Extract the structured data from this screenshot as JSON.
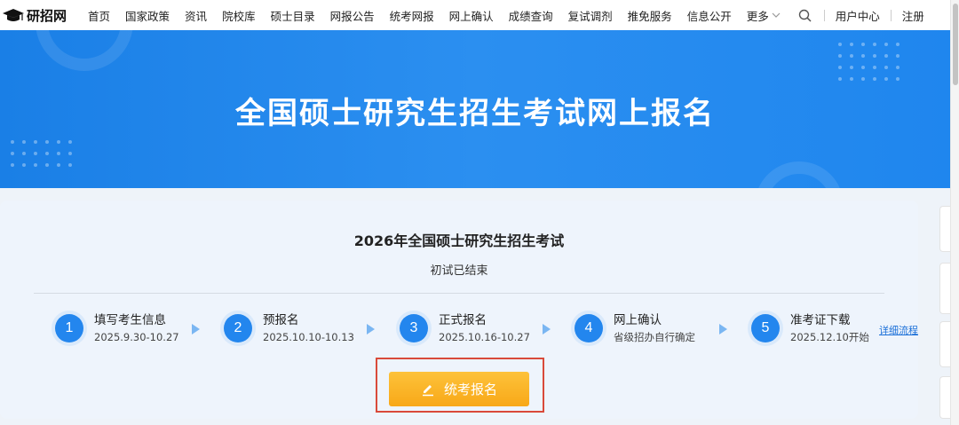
{
  "nav": {
    "logo_text": "研招网",
    "items": [
      "首页",
      "国家政策",
      "资讯",
      "院校库",
      "硕士目录",
      "网报公告",
      "统考网报",
      "网上确认",
      "成绩查询",
      "复试调剂",
      "推免服务",
      "信息公开"
    ],
    "more": "更多",
    "user_center": "用户中心",
    "register": "注册"
  },
  "banner": {
    "title": "全国硕士研究生招生考试网上报名"
  },
  "card": {
    "title": "2026年全国硕士研究生招生考试",
    "subtitle": "初试已结束",
    "steps": [
      {
        "num": "1",
        "label": "填写考生信息",
        "date": "2025.9.30-10.27"
      },
      {
        "num": "2",
        "label": "预报名",
        "date": "2025.10.10-10.13"
      },
      {
        "num": "3",
        "label": "正式报名",
        "date": "2025.10.16-10.27"
      },
      {
        "num": "4",
        "label": "网上确认",
        "date": "省级招办自行确定"
      },
      {
        "num": "5",
        "label": "准考证下载",
        "date": "2025.12.10开始"
      }
    ],
    "detail_link": "详细流程",
    "button_label": "统考报名"
  },
  "colors": {
    "brand_blue": "#2386ee",
    "button_orange": "#f8a818",
    "highlight_red": "#d94a3a"
  }
}
